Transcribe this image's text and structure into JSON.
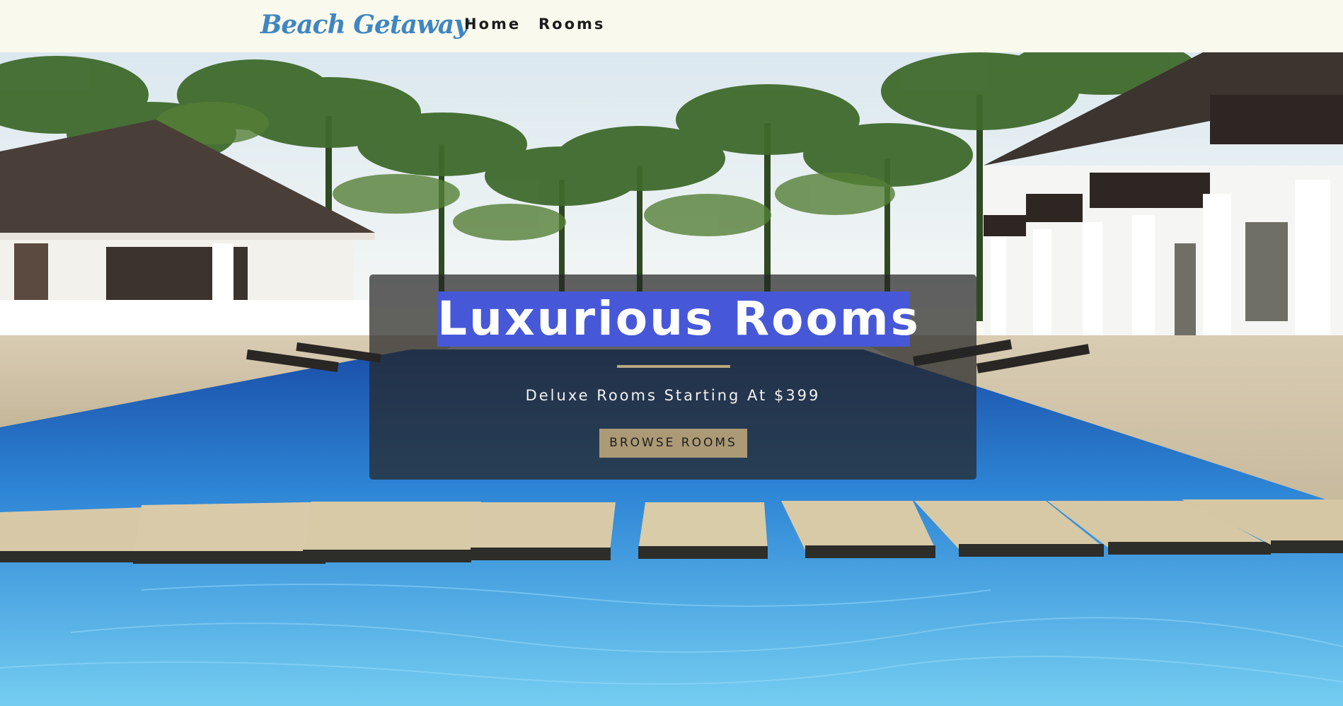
{
  "header": {
    "brand": "Beach Getaway",
    "nav": [
      "Home",
      "Rooms"
    ]
  },
  "hero": {
    "title": "Luxurious Rooms",
    "subtitle": "Deluxe Rooms Starting At $399",
    "button_label": "BROWSE ROOMS"
  },
  "colors": {
    "nav_background": "#faf9ee",
    "brand": "#3f86c2",
    "title_highlight": "#4658d8",
    "accent": "#ab9a75"
  }
}
